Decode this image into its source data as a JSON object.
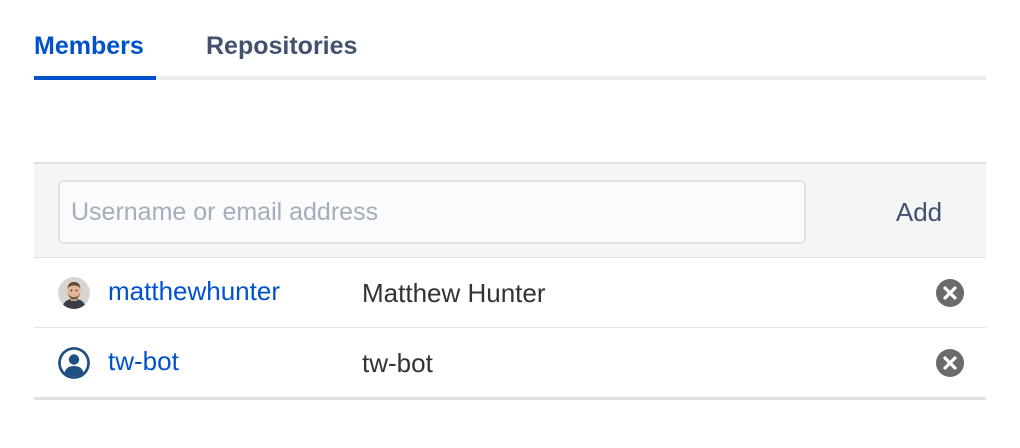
{
  "tabs": [
    {
      "label": "Members",
      "active": true
    },
    {
      "label": "Repositories",
      "active": false
    }
  ],
  "add_member": {
    "placeholder": "Username or email address",
    "value": "",
    "button_label": "Add"
  },
  "members": [
    {
      "username": "matthewhunter",
      "display_name": "Matthew Hunter",
      "avatar": "user-photo"
    },
    {
      "username": "tw-bot",
      "display_name": "tw-bot",
      "avatar": "default-user-icon"
    }
  ],
  "colors": {
    "accent": "#0052cc",
    "tab_inactive": "#42526e",
    "remove_icon": "#6b6b6b",
    "default_avatar": "#205081"
  }
}
